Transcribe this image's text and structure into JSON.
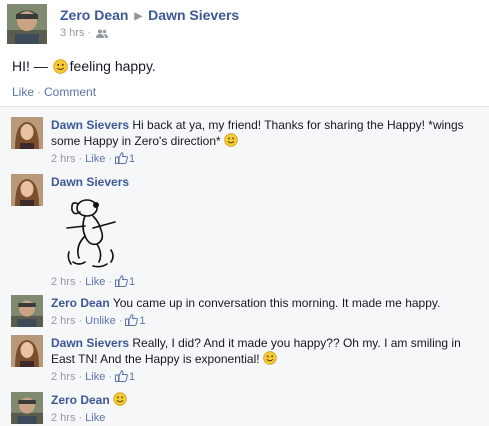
{
  "post": {
    "author": "Zero Dean",
    "target": "Dawn Sievers",
    "time": "3 hrs",
    "status_prefix": "HI! — ",
    "feeling": "feeling happy.",
    "actions": {
      "like": "Like",
      "comment": "Comment"
    }
  },
  "comments": [
    {
      "author": "Dawn Sievers",
      "text": "Hi back at ya, my friend! Thanks for sharing the Happy! *wings some Happy in Zero's direction*",
      "time": "2 hrs",
      "like_label": "Like",
      "like_count": "1"
    },
    {
      "author": "Dawn Sievers",
      "text": "",
      "time": "2 hrs",
      "like_label": "Like",
      "like_count": "1"
    },
    {
      "author": "Zero Dean",
      "text": "You came up in conversation this morning. It made me happy.",
      "time": "2 hrs",
      "like_label": "Unlike",
      "like_count": "1"
    },
    {
      "author": "Dawn Sievers",
      "text": "Really, I did? And it made you happy?? Oh my. I am smiling in East TN! And the Happy is exponential!",
      "time": "2 hrs",
      "like_label": "Like",
      "like_count": "1"
    },
    {
      "author": "Zero Dean",
      "text": "",
      "time": "2 hrs",
      "like_label": "Like"
    }
  ],
  "separator": "·",
  "colors": {
    "link": "#3b5998",
    "meta": "#9197a3",
    "smiley": "#f7c935"
  },
  "icons": [
    "friends-icon",
    "smiley-icon",
    "like-thumb-icon",
    "snoopy-dance-sticker"
  ]
}
